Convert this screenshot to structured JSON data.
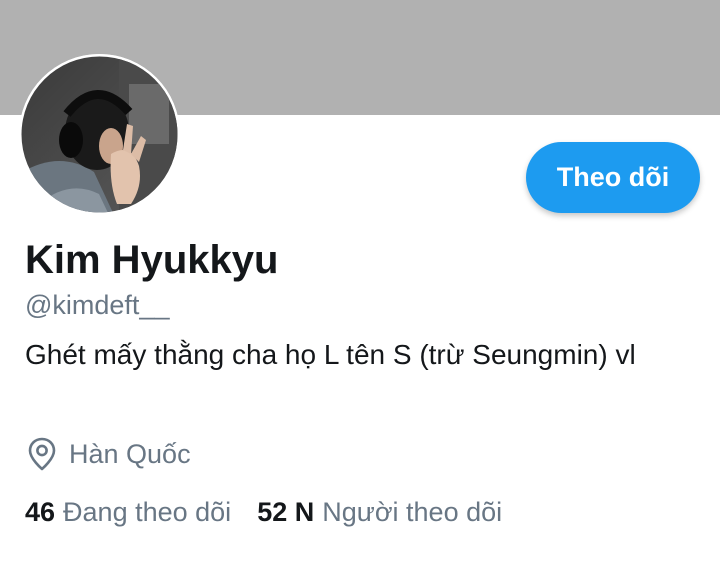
{
  "colors": {
    "banner": "#b1b1b1",
    "accent": "#1d9bf0",
    "text_primary": "#14171a",
    "text_secondary": "#687684"
  },
  "profile": {
    "display_name": "Kim Hyukkyu",
    "handle": "@kimdeft__",
    "bio": "Ghét mấy thằng cha họ L tên S (trừ Seungmin) vl",
    "location": "Hàn Quốc",
    "location_icon": "map-pin-icon",
    "avatar_icon": "profile-photo"
  },
  "actions": {
    "follow_label": "Theo dõi"
  },
  "stats": {
    "following_count": "46",
    "following_label": "Đang theo dõi",
    "followers_count": "52 N",
    "followers_label": "Người theo dõi"
  }
}
